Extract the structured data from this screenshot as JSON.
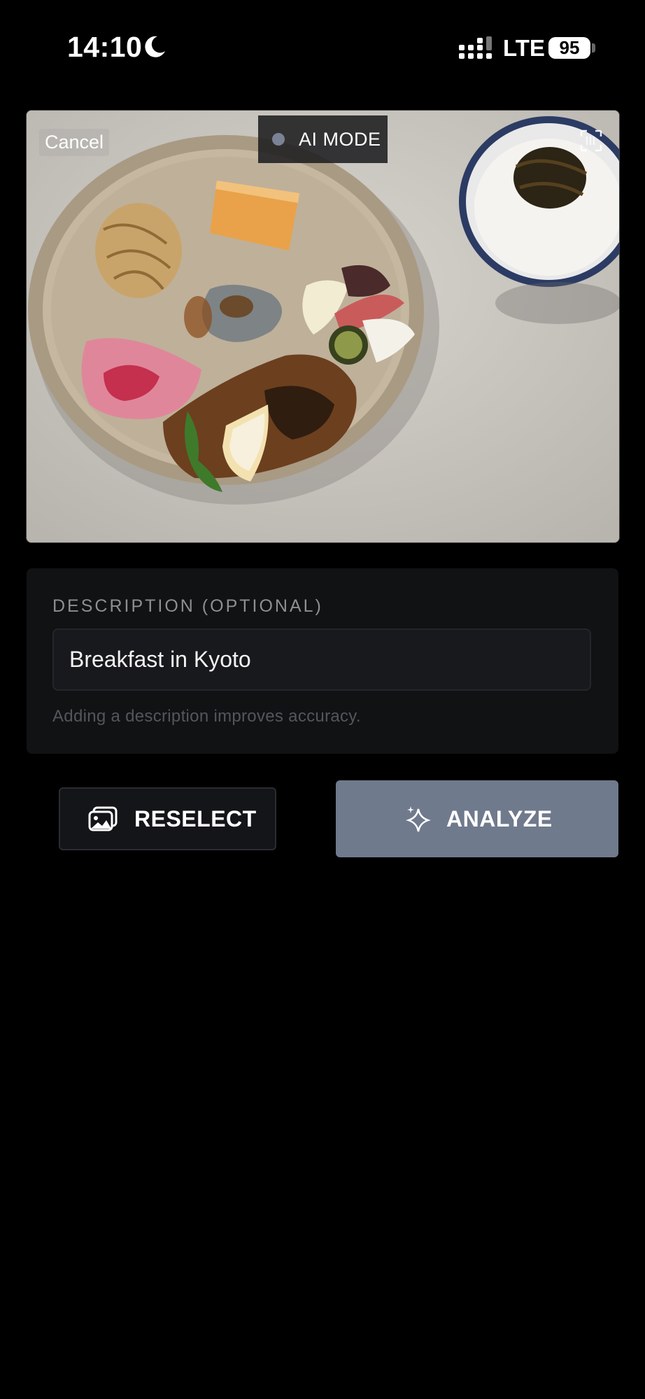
{
  "status_bar": {
    "time": "14:10",
    "network": "LTE",
    "battery": "95"
  },
  "photo": {
    "cancel_label": "Cancel",
    "mode_label": "AI MODE",
    "mode_dot_color": "#7a8295"
  },
  "description": {
    "title": "DESCRIPTION (OPTIONAL)",
    "value": "Breakfast in Kyoto",
    "hint": "Adding a description improves accuracy."
  },
  "actions": {
    "reselect_label": "RESELECT",
    "analyze_label": "ANALYZE",
    "analyze_color": "#707a8d"
  },
  "icons": {
    "moon": "moon-icon",
    "signal": "signal-icon",
    "scan": "scan-icon",
    "reselect": "photo-gallery-icon",
    "analyze": "sparkle-icon"
  }
}
